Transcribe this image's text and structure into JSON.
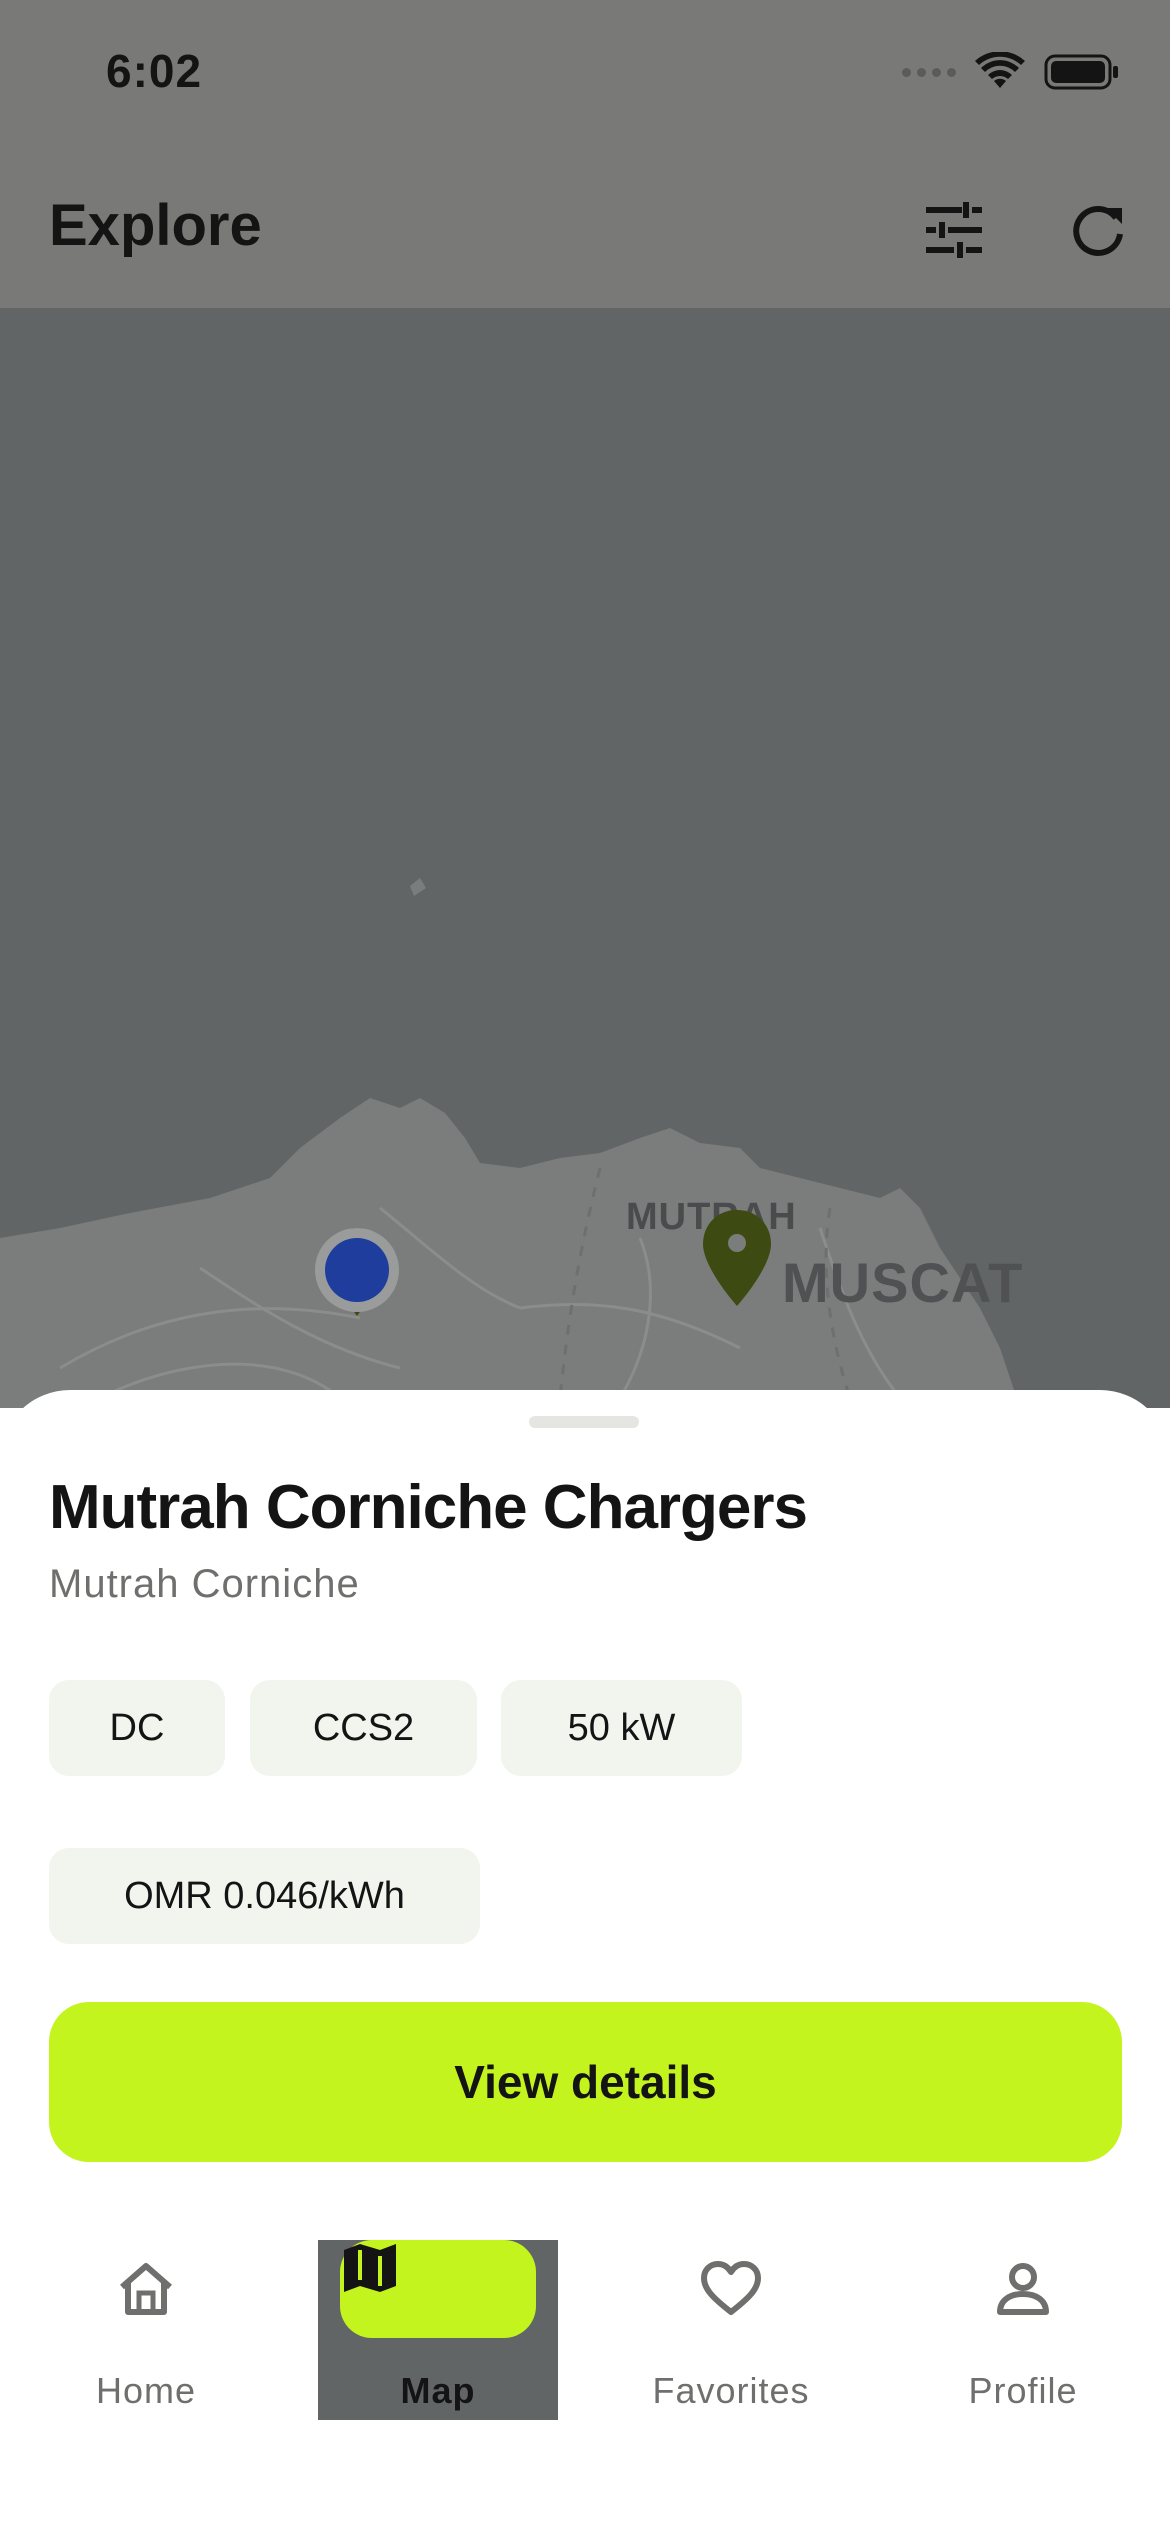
{
  "status_bar": {
    "time": "6:02"
  },
  "header": {
    "title": "Explore",
    "filter_icon": "sliders-icon",
    "refresh_icon": "refresh-icon"
  },
  "map": {
    "labels": {
      "mutrah": "MUTRAH",
      "muscat": "MUSCAT"
    },
    "colors": {
      "water": "#626566",
      "land": "#7a7b7b",
      "marker": "#3d4a12",
      "user": "#1e3d9c"
    }
  },
  "sheet": {
    "station_name": "Mutrah Corniche Chargers",
    "location": "Mutrah Corniche",
    "tags": [
      "DC",
      "CCS2",
      "50 kW",
      "OMR 0.046/kWh"
    ],
    "primary_button": "View details"
  },
  "nav": {
    "items": [
      {
        "label": "Home",
        "icon": "home-icon"
      },
      {
        "label": "Map",
        "icon": "map-icon",
        "active": true
      },
      {
        "label": "Favorites",
        "icon": "heart-icon"
      },
      {
        "label": "Profile",
        "icon": "person-icon"
      }
    ]
  },
  "colors": {
    "accent": "#c3f41d",
    "text": "#141414",
    "muted": "#6f706d",
    "tag_bg": "#f2f4ee"
  }
}
